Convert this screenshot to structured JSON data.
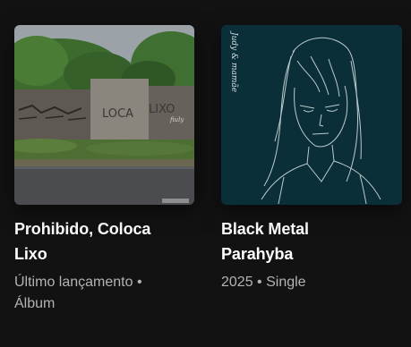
{
  "cards": [
    {
      "title": "Prohibido, Coloca Lixo",
      "subtitle": "Último lançamento • Álbum",
      "cover": {
        "graffiti_1": "LOCA",
        "graffiti_2": "LIXO",
        "graffiti_3": "fiuly"
      }
    },
    {
      "title": "Black Metal Parahyba",
      "subtitle": "2025 • Single",
      "cover": {
        "handwriting": "Judy & mamãe",
        "background": "#0b2f38"
      }
    }
  ],
  "colors": {
    "background": "#121212",
    "title": "#ffffff",
    "subtitle": "#b3b3b3"
  }
}
